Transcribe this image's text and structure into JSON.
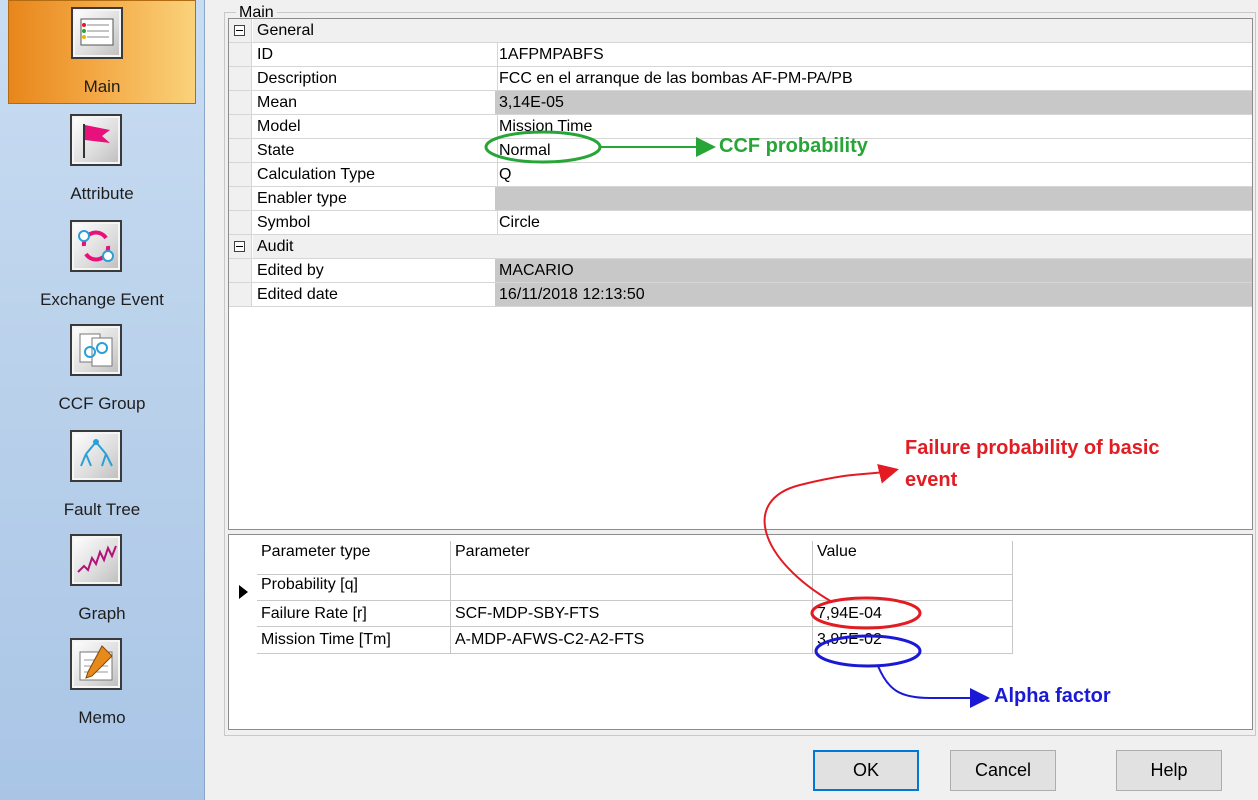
{
  "sidebar": {
    "items": [
      {
        "label": "Main",
        "icon": "main-list-icon",
        "active": true
      },
      {
        "label": "Attribute",
        "icon": "flag-icon"
      },
      {
        "label": "Exchange Event",
        "icon": "exchange-icon"
      },
      {
        "label": "CCF Group",
        "icon": "ccf-group-icon"
      },
      {
        "label": "Fault Tree",
        "icon": "fault-tree-icon"
      },
      {
        "label": "Graph",
        "icon": "graph-icon"
      },
      {
        "label": "Memo",
        "icon": "memo-icon"
      }
    ],
    "colors": {
      "active_start": "#e8861b",
      "active_end": "#fad27a",
      "background": "#b7cfea"
    }
  },
  "group_title": "Main",
  "properties": {
    "categories": [
      {
        "name": "General",
        "rows": [
          {
            "name": "ID",
            "value": "1AFPMPABFS",
            "readonly": false
          },
          {
            "name": "Description",
            "value": "FCC en el arranque de las bombas AF-PM-PA/PB",
            "readonly": false
          },
          {
            "name": "Mean",
            "value": "3,14E-05",
            "readonly": true
          },
          {
            "name": "Model",
            "value": "Mission Time",
            "readonly": false
          },
          {
            "name": "State",
            "value": "Normal",
            "readonly": false
          },
          {
            "name": "Calculation Type",
            "value": "Q",
            "readonly": false
          },
          {
            "name": "Enabler type",
            "value": "",
            "readonly": true
          },
          {
            "name": "Symbol",
            "value": "Circle",
            "readonly": false
          }
        ]
      },
      {
        "name": "Audit",
        "rows": [
          {
            "name": "Edited by",
            "value": "MACARIO",
            "readonly": true
          },
          {
            "name": "Edited date",
            "value": "16/11/2018 12:13:50",
            "readonly": true
          }
        ]
      }
    ]
  },
  "parameters": {
    "headers": [
      "Parameter type",
      "Parameter",
      "Value"
    ],
    "rows": [
      [
        "Probability [q]",
        "",
        ""
      ],
      [
        "Failure Rate [r]",
        "SCF-MDP-SBY-FTS",
        "7,94E-04"
      ],
      [
        "Mission Time [Tm]",
        "A-MDP-AFWS-C2-A2-FTS",
        "3,95E-02"
      ]
    ]
  },
  "buttons": {
    "ok": "OK",
    "cancel": "Cancel",
    "help": "Help"
  },
  "annotations": {
    "ccf": {
      "text": "CCF probability",
      "color": "#27a537"
    },
    "failure": {
      "line1": "Failure probability of basic",
      "line2": "event",
      "color": "#e31b23"
    },
    "alpha": {
      "text": "Alpha factor",
      "color": "#1a1ad6"
    }
  }
}
